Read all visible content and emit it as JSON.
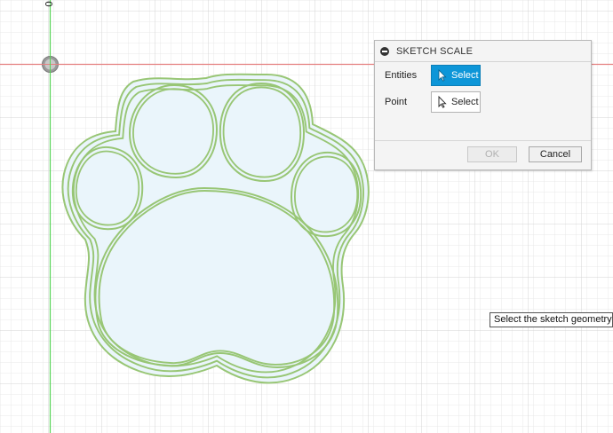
{
  "viewport": {
    "axis_label": "0",
    "origin_icon": "origin-point-icon",
    "paw_icon": "paw-sketch-geometry"
  },
  "dialog": {
    "title": "SKETCH SCALE",
    "collapse_icon": "collapse-icon",
    "rows": [
      {
        "label": "Entities",
        "button": "Select",
        "active": true
      },
      {
        "label": "Point",
        "button": "Select",
        "active": false
      }
    ],
    "ok_label": "OK",
    "cancel_label": "Cancel"
  },
  "tooltip": {
    "text": "Select the sketch geometry"
  },
  "colors": {
    "grid_minor": "#e8e8e8",
    "grid_major": "#d2d2d2",
    "x_axis": "#e58080",
    "y_axis": "#55d455",
    "sketch_line": "#98c675",
    "sketch_fill": "#eaf5fb",
    "select_active": "#0d96d8"
  }
}
